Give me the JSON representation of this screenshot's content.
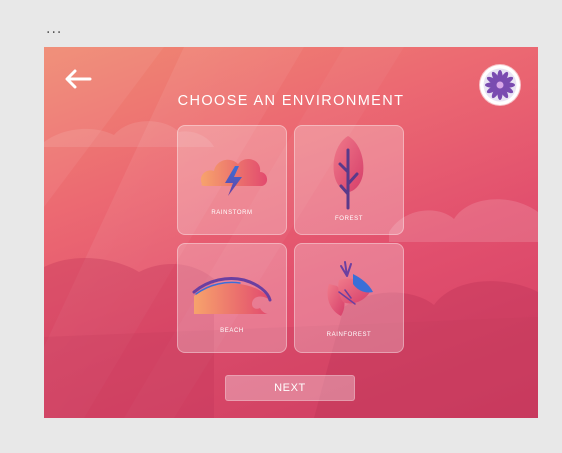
{
  "window": {
    "menu_dots": "..."
  },
  "header": {
    "title": "CHOOSE AN ENVIRONMENT"
  },
  "tiles": [
    {
      "label": "RAINSTORM",
      "icon": "rainstorm-icon"
    },
    {
      "label": "FOREST",
      "icon": "tree-icon"
    },
    {
      "label": "BEACH",
      "icon": "wave-icon"
    },
    {
      "label": "RAINFOREST",
      "icon": "tropical-leaves-icon"
    }
  ],
  "footer": {
    "next_label": "NEXT"
  },
  "colors": {
    "background_top": "#f08a72",
    "background_bottom": "#d23e64",
    "accent_purple": "#6b3fa0",
    "accent_blue": "#3a6fd8",
    "accent_pink": "#e24a6e"
  }
}
